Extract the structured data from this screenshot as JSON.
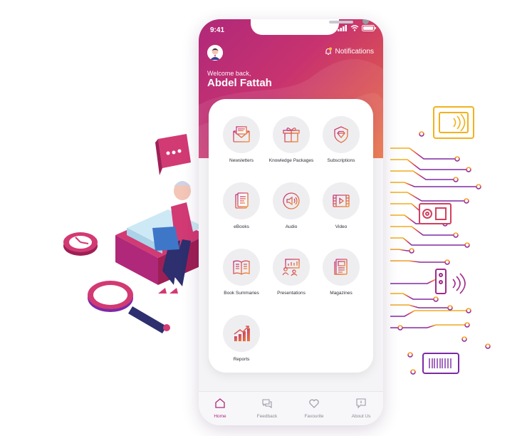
{
  "status_bar": {
    "time": "9:41"
  },
  "header": {
    "notifications_label": "Notifications",
    "welcome_text": "Welcome back,",
    "user_name": "Abdel Fattah"
  },
  "menu": {
    "items": [
      {
        "label": "Newsletters",
        "icon": "envelope-icon"
      },
      {
        "label": "Knowledge Packages",
        "icon": "gift-box-icon"
      },
      {
        "label": "Subscriptions",
        "icon": "diamond-shield-icon"
      },
      {
        "label": "eBooks",
        "icon": "ebook-icon"
      },
      {
        "label": "Audio",
        "icon": "speaker-icon"
      },
      {
        "label": "Video",
        "icon": "film-play-icon"
      },
      {
        "label": "Book Summaries",
        "icon": "open-book-icon"
      },
      {
        "label": "Presentations",
        "icon": "presentation-board-icon"
      },
      {
        "label": "Magazines",
        "icon": "magazine-icon"
      },
      {
        "label": "Reports",
        "icon": "growth-chart-icon"
      }
    ]
  },
  "bottom_nav": {
    "items": [
      {
        "label": "Home",
        "icon": "home-icon",
        "active": true
      },
      {
        "label": "Feedback",
        "icon": "chat-bubbles-icon",
        "active": false
      },
      {
        "label": "Favourite",
        "icon": "heart-icon",
        "active": false
      },
      {
        "label": "About Us",
        "icon": "info-bubble-icon",
        "active": false
      }
    ]
  },
  "colors": {
    "brand_magenta": "#b0287a",
    "brand_orange": "#e86a3c",
    "circuit_gold": "#f0b21e",
    "circuit_purple": "#8a2aa0"
  }
}
